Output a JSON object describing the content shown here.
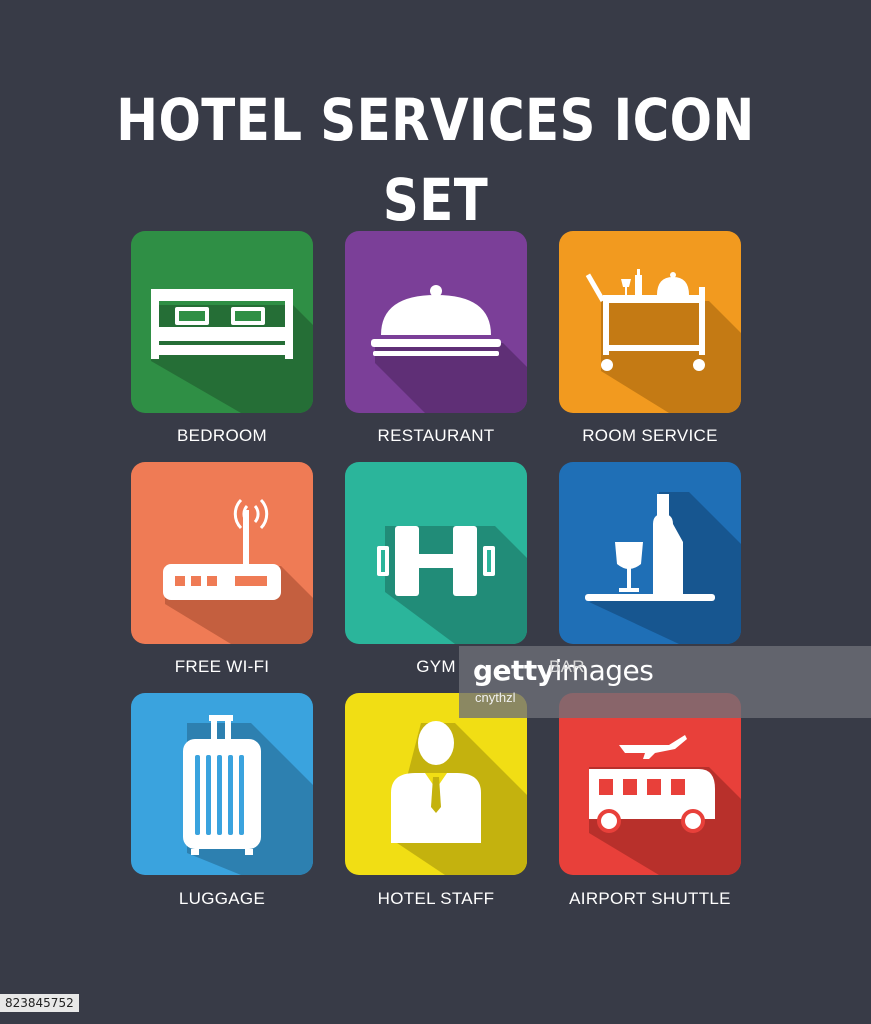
{
  "title": "HOTEL SERVICES ICON SET",
  "icons": [
    {
      "label": "BEDROOM",
      "icon": "bed-icon",
      "color": "#2f8f45",
      "shadow": "#256e36"
    },
    {
      "label": "RESTAURANT",
      "icon": "cloche-icon",
      "color": "#7b3f98",
      "shadow": "#5f2f76"
    },
    {
      "label": "ROOM SERVICE",
      "icon": "service-cart-icon",
      "color": "#f29a1f",
      "shadow": "#c47a14"
    },
    {
      "label": "FREE WI-FI",
      "icon": "wifi-router-icon",
      "color": "#ef7b55",
      "shadow": "#c45f3f"
    },
    {
      "label": "GYM",
      "icon": "dumbbell-icon",
      "color": "#2bb59b",
      "shadow": "#218c78"
    },
    {
      "label": "BAR",
      "icon": "wine-icon",
      "color": "#1f6fb6",
      "shadow": "#175690"
    },
    {
      "label": "LUGGAGE",
      "icon": "suitcase-icon",
      "color": "#3aa3de",
      "shadow": "#2d80b0"
    },
    {
      "label": "HOTEL STAFF",
      "icon": "staff-icon",
      "color": "#f1de14",
      "shadow": "#c4b20e"
    },
    {
      "label": "AIRPORT SHUTTLE",
      "icon": "shuttle-bus-icon",
      "color": "#e8403a",
      "shadow": "#b8302b"
    }
  ],
  "watermark": {
    "brand_bold": "getty",
    "brand_regular": "images",
    "credit": "cnythzl"
  },
  "image_id": "823845752"
}
